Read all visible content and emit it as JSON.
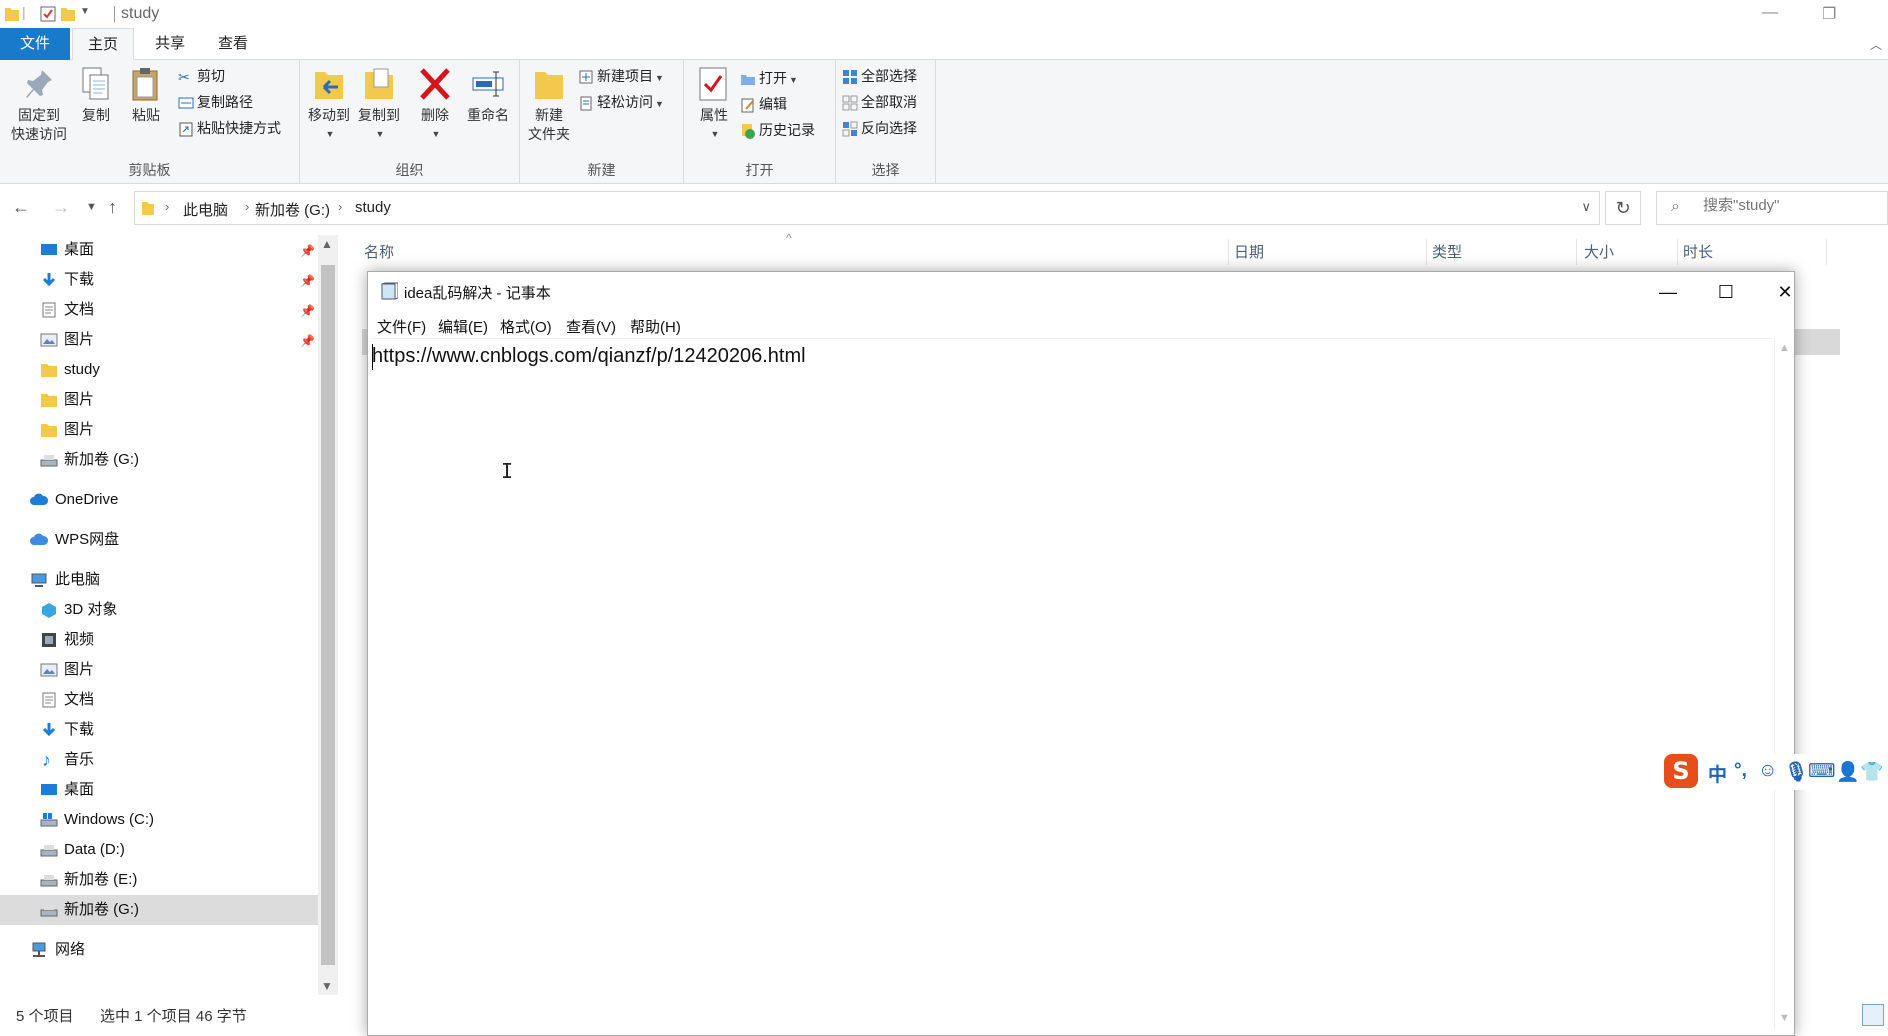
{
  "explorer": {
    "title": "study",
    "window_controls": {
      "minimize": "—",
      "restore": "❐",
      "close": "✕"
    }
  },
  "ribbon_tabs": {
    "file": "文件",
    "home": "主页",
    "share": "共享",
    "view": "查看"
  },
  "ribbon": {
    "clipboard": {
      "label": "剪贴板",
      "pin_line1": "固定到",
      "pin_line2": "快速访问",
      "copy": "复制",
      "paste": "粘贴",
      "cut": "剪切",
      "copy_path": "复制路径",
      "paste_shortcut": "粘贴快捷方式"
    },
    "organize": {
      "label": "组织",
      "move_to": "移动到",
      "copy_to": "复制到",
      "delete": "删除",
      "rename": "重命名"
    },
    "new": {
      "label": "新建",
      "new_folder_line1": "新建",
      "new_folder_line2": "文件夹",
      "new_item": "新建项目",
      "easy_access": "轻松访问"
    },
    "open": {
      "label": "打开",
      "properties": "属性",
      "open": "打开",
      "edit": "编辑",
      "history": "历史记录"
    },
    "select": {
      "label": "选择",
      "select_all": "全部选择",
      "select_none": "全部取消",
      "invert": "反向选择"
    }
  },
  "address": {
    "crumbs": [
      "此电脑",
      "新加卷 (G:)",
      "study"
    ],
    "search_placeholder": "搜索\"study\""
  },
  "nav_pane": {
    "items": [
      {
        "label": "桌面",
        "icon": "desktop-icon",
        "pinned": true
      },
      {
        "label": "下载",
        "icon": "download-icon",
        "pinned": true
      },
      {
        "label": "文档",
        "icon": "document-icon",
        "pinned": true
      },
      {
        "label": "图片",
        "icon": "picture-icon",
        "pinned": true
      },
      {
        "label": "study",
        "icon": "folder-icon",
        "pinned": false
      },
      {
        "label": "图片",
        "icon": "folder-icon",
        "pinned": false
      },
      {
        "label": "图片",
        "icon": "folder-icon",
        "pinned": false
      },
      {
        "label": "新加卷 (G:)",
        "icon": "drive-icon",
        "pinned": false
      },
      {
        "label": "OneDrive",
        "icon": "cloud-icon"
      },
      {
        "label": "WPS网盘",
        "icon": "cloud-icon"
      },
      {
        "label": "此电脑",
        "icon": "computer-icon"
      },
      {
        "label": "3D 对象",
        "icon": "cube-icon"
      },
      {
        "label": "视频",
        "icon": "video-icon"
      },
      {
        "label": "图片",
        "icon": "picture-icon"
      },
      {
        "label": "文档",
        "icon": "document-icon"
      },
      {
        "label": "下载",
        "icon": "download-icon"
      },
      {
        "label": "音乐",
        "icon": "music-icon"
      },
      {
        "label": "桌面",
        "icon": "desktop-icon"
      },
      {
        "label": "Windows (C:)",
        "icon": "windows-drive-icon"
      },
      {
        "label": "Data (D:)",
        "icon": "drive-icon"
      },
      {
        "label": "新加卷 (E:)",
        "icon": "drive-icon"
      },
      {
        "label": "新加卷 (G:)",
        "icon": "drive-icon",
        "selected": true
      },
      {
        "label": "网络",
        "icon": "network-icon"
      }
    ]
  },
  "file_list": {
    "columns": [
      "名称",
      "日期",
      "类型",
      "大小",
      "时长"
    ]
  },
  "status": {
    "count": "5 个项目",
    "selection": "选中 1 个项目  46 字节"
  },
  "notepad": {
    "title": "idea乱码解决 - 记事本",
    "menu": [
      "文件(F)",
      "编辑(E)",
      "格式(O)",
      "查看(V)",
      "帮助(H)"
    ],
    "content": "https://www.cnblogs.com/qianzf/p/12420206.html",
    "controls": {
      "minimize": "—",
      "maximize": "☐",
      "close": "✕"
    }
  },
  "ime": {
    "logo": "S",
    "mode": "中",
    "punct": "°,"
  },
  "colors": {
    "accent": "#1979ca",
    "ribbon_bg": "#f5f6f7",
    "selected_bg": "#dcdcdc"
  }
}
